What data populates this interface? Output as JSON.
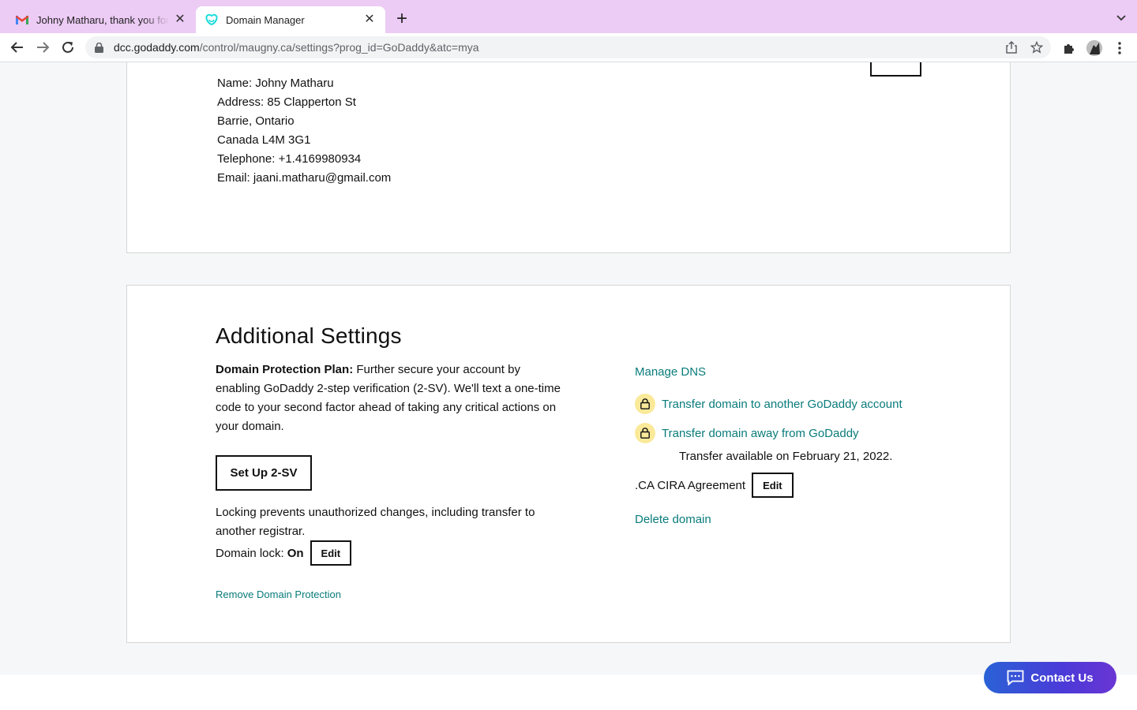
{
  "browser": {
    "tabs": [
      {
        "title": "Johny Matharu, thank you for your purchase",
        "favicon": "gmail-icon"
      },
      {
        "title": "Domain Manager",
        "favicon": "godaddy-icon"
      }
    ],
    "url_host": "dcc.godaddy.com",
    "url_path": "/control/maugny.ca/settings?prog_id=GoDaddy&atc=mya"
  },
  "contact": {
    "name": "Name: Johny Matharu",
    "address": "Address: 85 Clapperton St",
    "city": "Barrie, Ontario",
    "country_postal": "Canada L4M 3G1",
    "telephone": "Telephone: +1.4169980934",
    "email": "Email: jaani.matharu@gmail.com"
  },
  "settings": {
    "title": "Additional Settings",
    "dpp_label": "Domain Protection Plan:",
    "dpp_text": " Further secure your account by enabling GoDaddy 2-step verification (2-SV). We'll text a one-time code to your second factor ahead of taking any critical actions on your domain.",
    "setup_2sv_label": "Set Up 2-SV",
    "lock_description": "Locking prevents unauthorized changes, including transfer to another registrar.",
    "domain_lock_label": "Domain lock:",
    "domain_lock_value": "On",
    "edit_label": "Edit",
    "remove_protection_label": "Remove Domain Protection",
    "manage_dns_label": "Manage DNS",
    "transfer_account_label": "Transfer domain to another GoDaddy account",
    "transfer_away_label": "Transfer domain away from GoDaddy",
    "transfer_note": "Transfer available on February 21, 2022.",
    "cira_label": ".CA CIRA Agreement",
    "cira_edit_label": "Edit",
    "delete_label": "Delete domain"
  },
  "contact_us_label": "Contact Us",
  "colors": {
    "tab_strip": "#eccbf5",
    "link": "#0a7b7b",
    "lock_badge": "#fbe99a",
    "contact_button": "#4b3ad8"
  }
}
